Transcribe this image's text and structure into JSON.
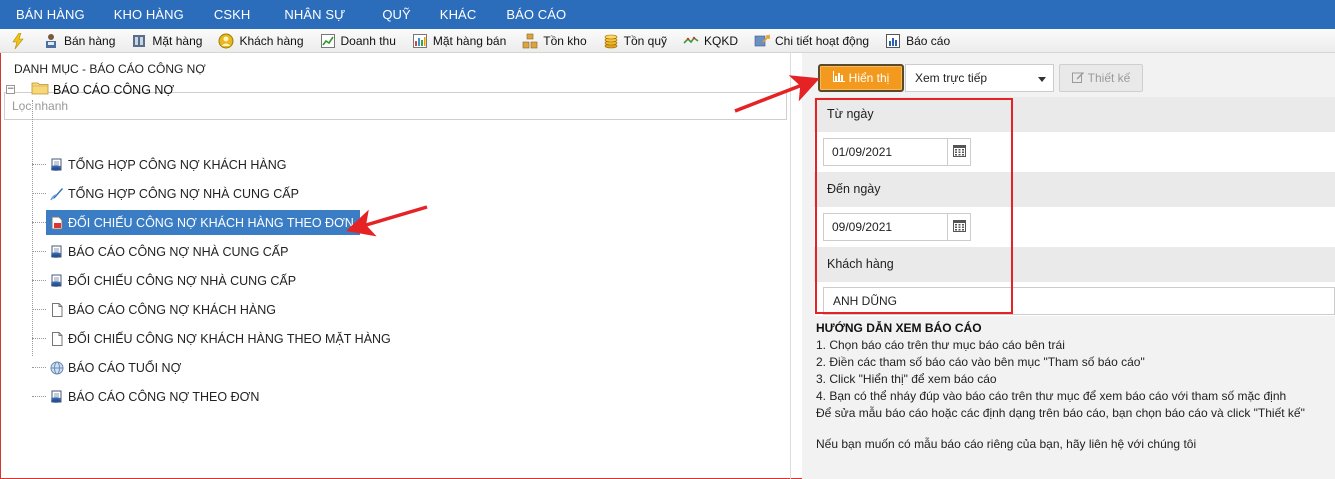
{
  "top_menu": [
    "BÁN HÀNG",
    "KHO HÀNG",
    "CSKH",
    "NHÂN SỰ",
    "QUỸ",
    "KHÁC",
    "BÁO CÁO"
  ],
  "toolbar": [
    {
      "label": "",
      "icon": "lightning-icon"
    },
    {
      "label": "Bán hàng",
      "icon": "cashier-icon"
    },
    {
      "label": "Mặt hàng",
      "icon": "goods-icon"
    },
    {
      "label": "Khách hàng",
      "icon": "customer-icon"
    },
    {
      "label": "Doanh thu",
      "icon": "revenue-icon"
    },
    {
      "label": "Mặt hàng bán",
      "icon": "sales-chart-icon"
    },
    {
      "label": "Tồn kho",
      "icon": "inventory-icon"
    },
    {
      "label": "Tồn quỹ",
      "icon": "coins-icon"
    },
    {
      "label": "KQKD",
      "icon": "trend-icon"
    },
    {
      "label": "Chi tiết hoạt động",
      "icon": "activity-icon"
    },
    {
      "label": "Báo cáo",
      "icon": "report-icon"
    }
  ],
  "left": {
    "title": "DANH MỤC - BÁO CÁO CÔNG NỢ",
    "search_placeholder": "Lọc nhanh",
    "root_label": "BÁO CÁO CÔNG NỢ",
    "items": [
      {
        "label": "TỔNG HỢP CÔNG NỢ KHÁCH HÀNG",
        "icon": "report-db-icon",
        "selected": false
      },
      {
        "label": "TỔNG HỢP CÔNG NỢ NHÀ CUNG CẤP",
        "icon": "report-pen-icon",
        "selected": false
      },
      {
        "label": "ĐỐI CHIẾU CÔNG NỢ KHÁCH HÀNG THEO ĐƠN",
        "icon": "report-pdf-icon",
        "selected": true
      },
      {
        "label": "BÁO CÁO CÔNG NỢ NHÀ CUNG CẤP",
        "icon": "report-db-icon",
        "selected": false
      },
      {
        "label": "ĐỐI CHIẾU CÔNG NỢ NHÀ CUNG CẤP",
        "icon": "report-db-icon",
        "selected": false
      },
      {
        "label": "BÁO CÁO CÔNG NỢ KHÁCH HÀNG",
        "icon": "document-icon",
        "selected": false
      },
      {
        "label": "ĐỐI CHIẾU CÔNG NỢ KHÁCH HÀNG THEO MẶT HÀNG",
        "icon": "document-icon",
        "selected": false
      },
      {
        "label": "BÁO CÁO TUỔI NỢ",
        "icon": "globe-icon",
        "selected": false
      },
      {
        "label": "BÁO CÁO CÔNG NỢ THEO ĐƠN",
        "icon": "report-db-icon",
        "selected": false
      }
    ]
  },
  "right": {
    "show_button": "Hiển thị",
    "view_select": "Xem trực tiếp",
    "design_button": "Thiết kế",
    "from_label": "Từ ngày",
    "from_value": "01/09/2021",
    "to_label": "Đến ngày",
    "to_value": "09/09/2021",
    "customer_label": "Khách hàng",
    "customer_value": "ANH DŨNG"
  },
  "guide": {
    "title": "HƯỚNG DẪN XEM BÁO CÁO",
    "lines": [
      "1. Chọn báo cáo trên thư mục báo cáo bên trái",
      "2. Điền các tham số báo cáo vào bên mục \"Tham số báo cáo\"",
      "3. Click \"Hiển thị\" để xem báo cáo",
      "4. Bạn có thể nháy đúp vào báo cáo trên thư mục để xem báo cáo với tham số mặc định",
      "Để sửa mẫu báo cáo hoặc các định dạng trên báo cáo, bạn chọn báo cáo và click \"Thiết kế\""
    ],
    "footer": "Nếu bạn muốn có mẫu báo cáo riêng của bạn, hãy liên hệ với chúng tôi"
  },
  "colors": {
    "menu_bg": "#2b6dbb",
    "selected_bg": "#3b7dc4",
    "show_button": "#f39a1e",
    "annotation_red": "#e52325"
  }
}
